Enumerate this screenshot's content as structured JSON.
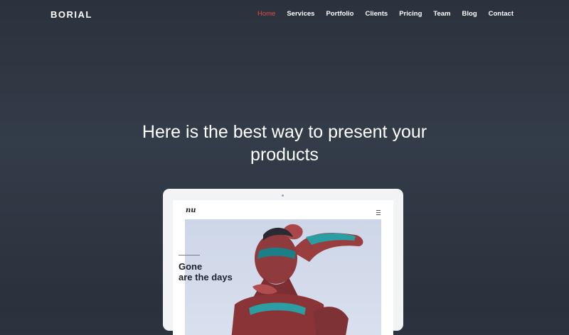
{
  "header": {
    "logo": "BORIAL",
    "nav": [
      {
        "label": "Home",
        "active": true
      },
      {
        "label": "Services",
        "active": false
      },
      {
        "label": "Portfolio",
        "active": false
      },
      {
        "label": "Clients",
        "active": false
      },
      {
        "label": "Pricing",
        "active": false
      },
      {
        "label": "Team",
        "active": false
      },
      {
        "label": "Blog",
        "active": false
      },
      {
        "label": "Contact",
        "active": false
      }
    ]
  },
  "hero": {
    "title_line1": "Here is the best way to present your",
    "title_line2": "products"
  },
  "device": {
    "site_logo": "nu",
    "headline_line1": "Gone",
    "headline_line2": "are the days"
  },
  "colors": {
    "active_nav": "#e14b47",
    "background_top": "#2b323d",
    "background_mid": "#333c49",
    "text": "#ffffff"
  }
}
